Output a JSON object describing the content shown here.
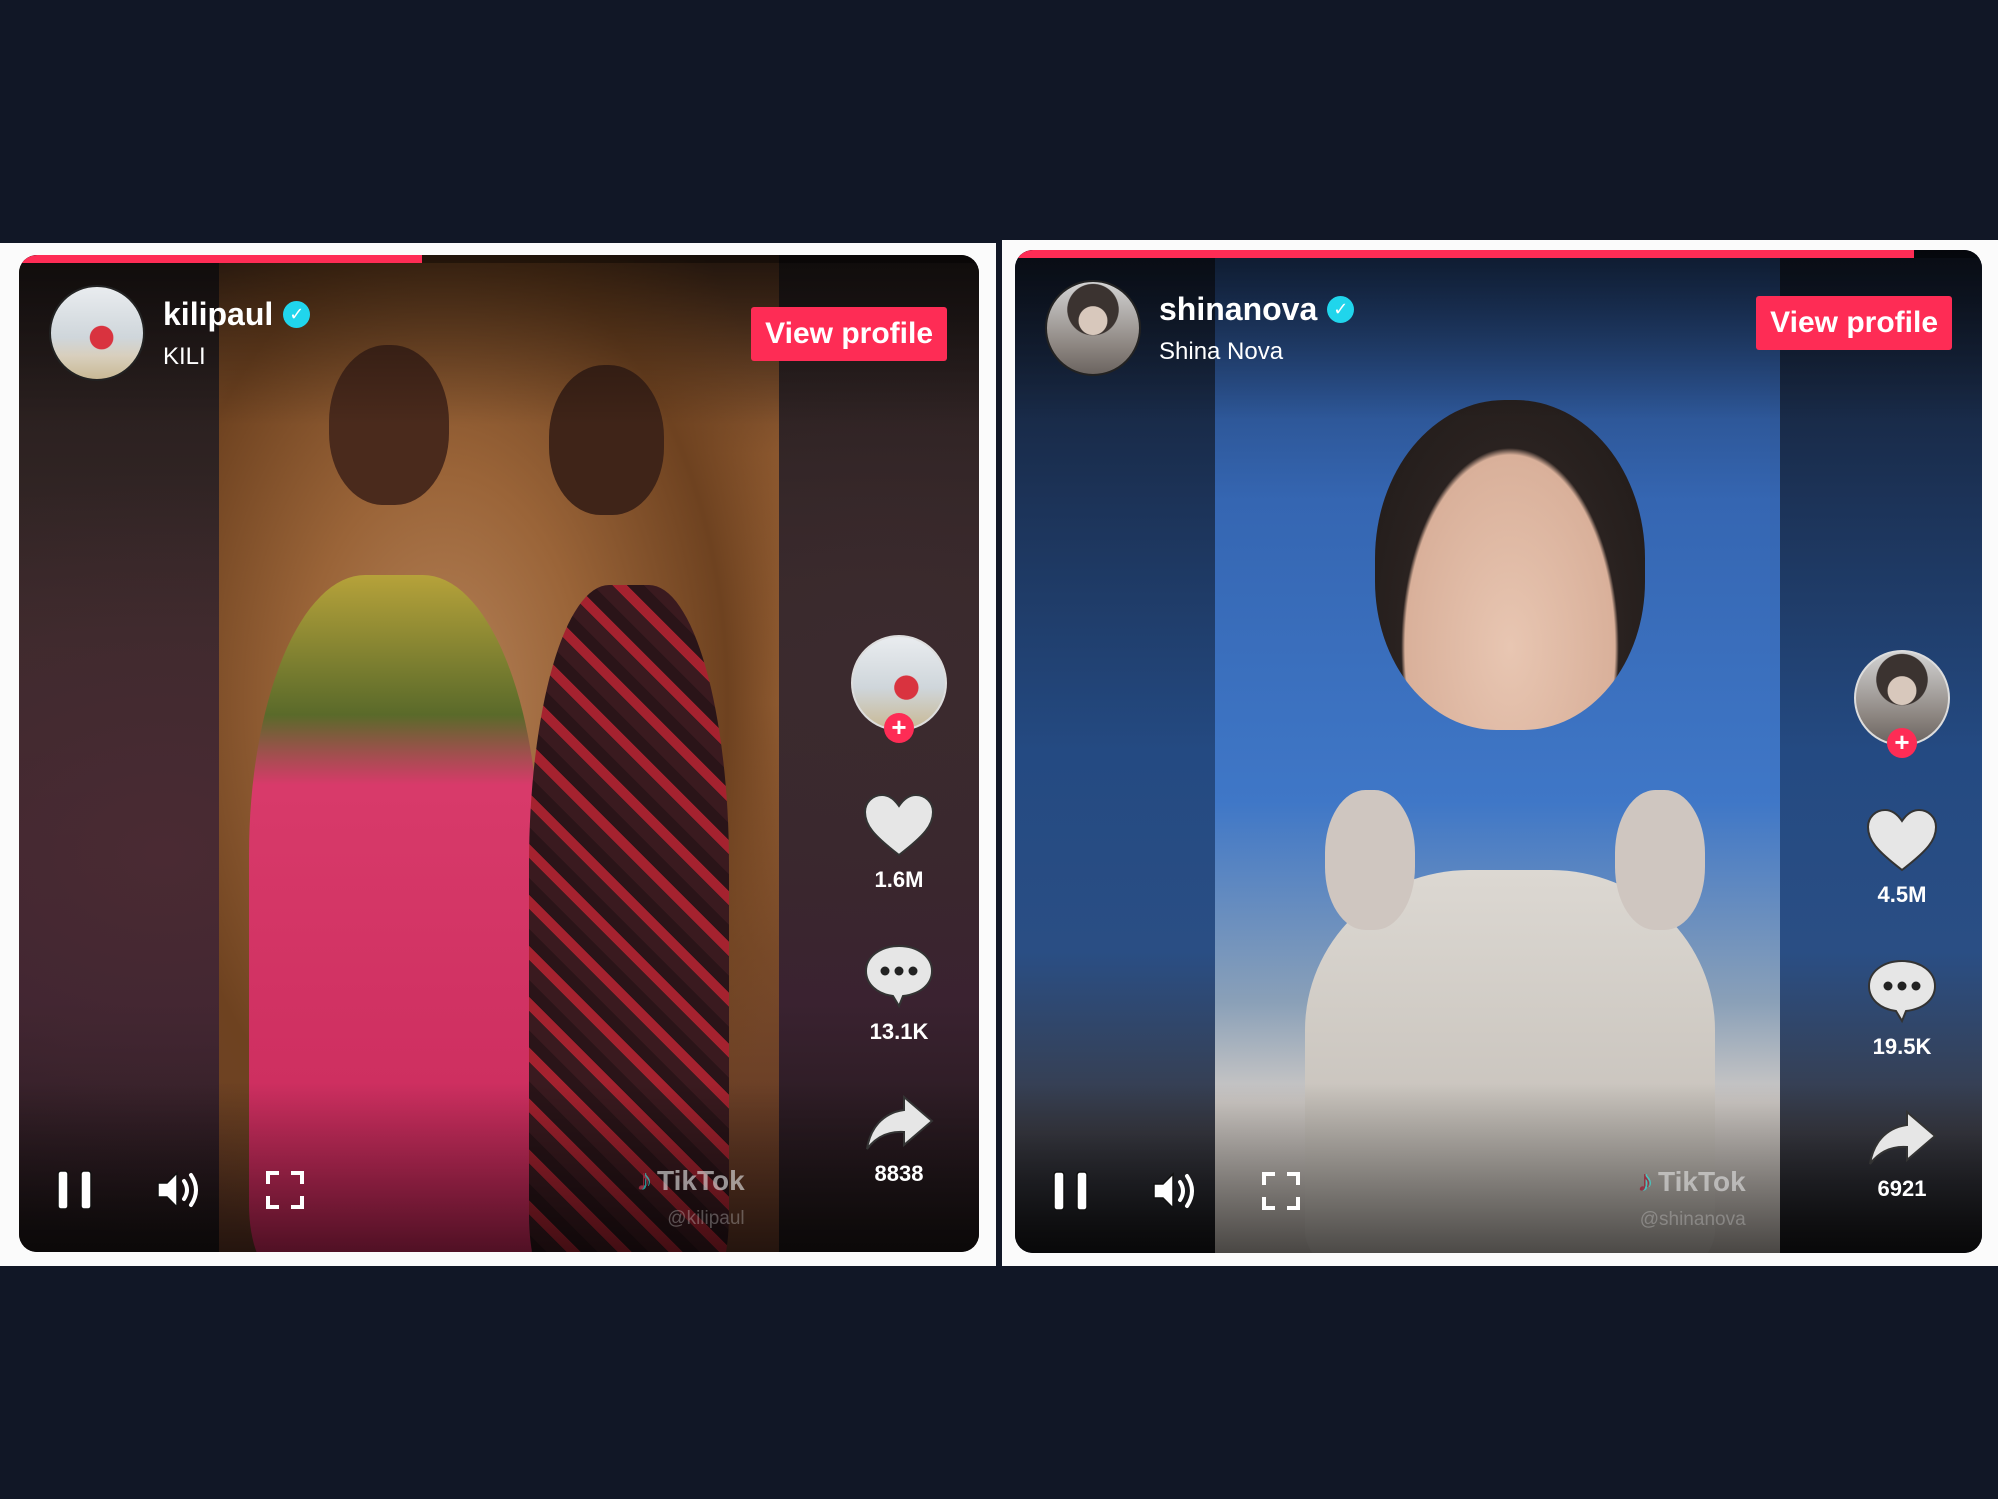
{
  "colors": {
    "background": "#111726",
    "accent": "#fe2c55",
    "verified": "#20d5ec"
  },
  "videos": [
    {
      "progress": 0.42,
      "username": "kilipaul",
      "display_name": "KILI",
      "verified_icon": "verified-check-icon",
      "view_profile_label": "View profile",
      "follow_label": "+",
      "likes": "1.6M",
      "comments": "13.1K",
      "shares": "8838",
      "watermark_brand": "TikTok",
      "watermark_handle": "@kilipaul",
      "icons": [
        "pause-icon",
        "volume-icon",
        "fullscreen-icon",
        "heart-icon",
        "comment-icon",
        "share-icon"
      ]
    },
    {
      "progress": 0.93,
      "username": "shinanova",
      "display_name": "Shina Nova",
      "verified_icon": "verified-check-icon",
      "view_profile_label": "View profile",
      "follow_label": "+",
      "likes": "4.5M",
      "comments": "19.5K",
      "shares": "6921",
      "watermark_brand": "TikTok",
      "watermark_handle": "@shinanova",
      "icons": [
        "pause-icon",
        "volume-icon",
        "fullscreen-icon",
        "heart-icon",
        "comment-icon",
        "share-icon"
      ]
    }
  ],
  "glyphs": {
    "check": "✓",
    "note": "♪"
  }
}
